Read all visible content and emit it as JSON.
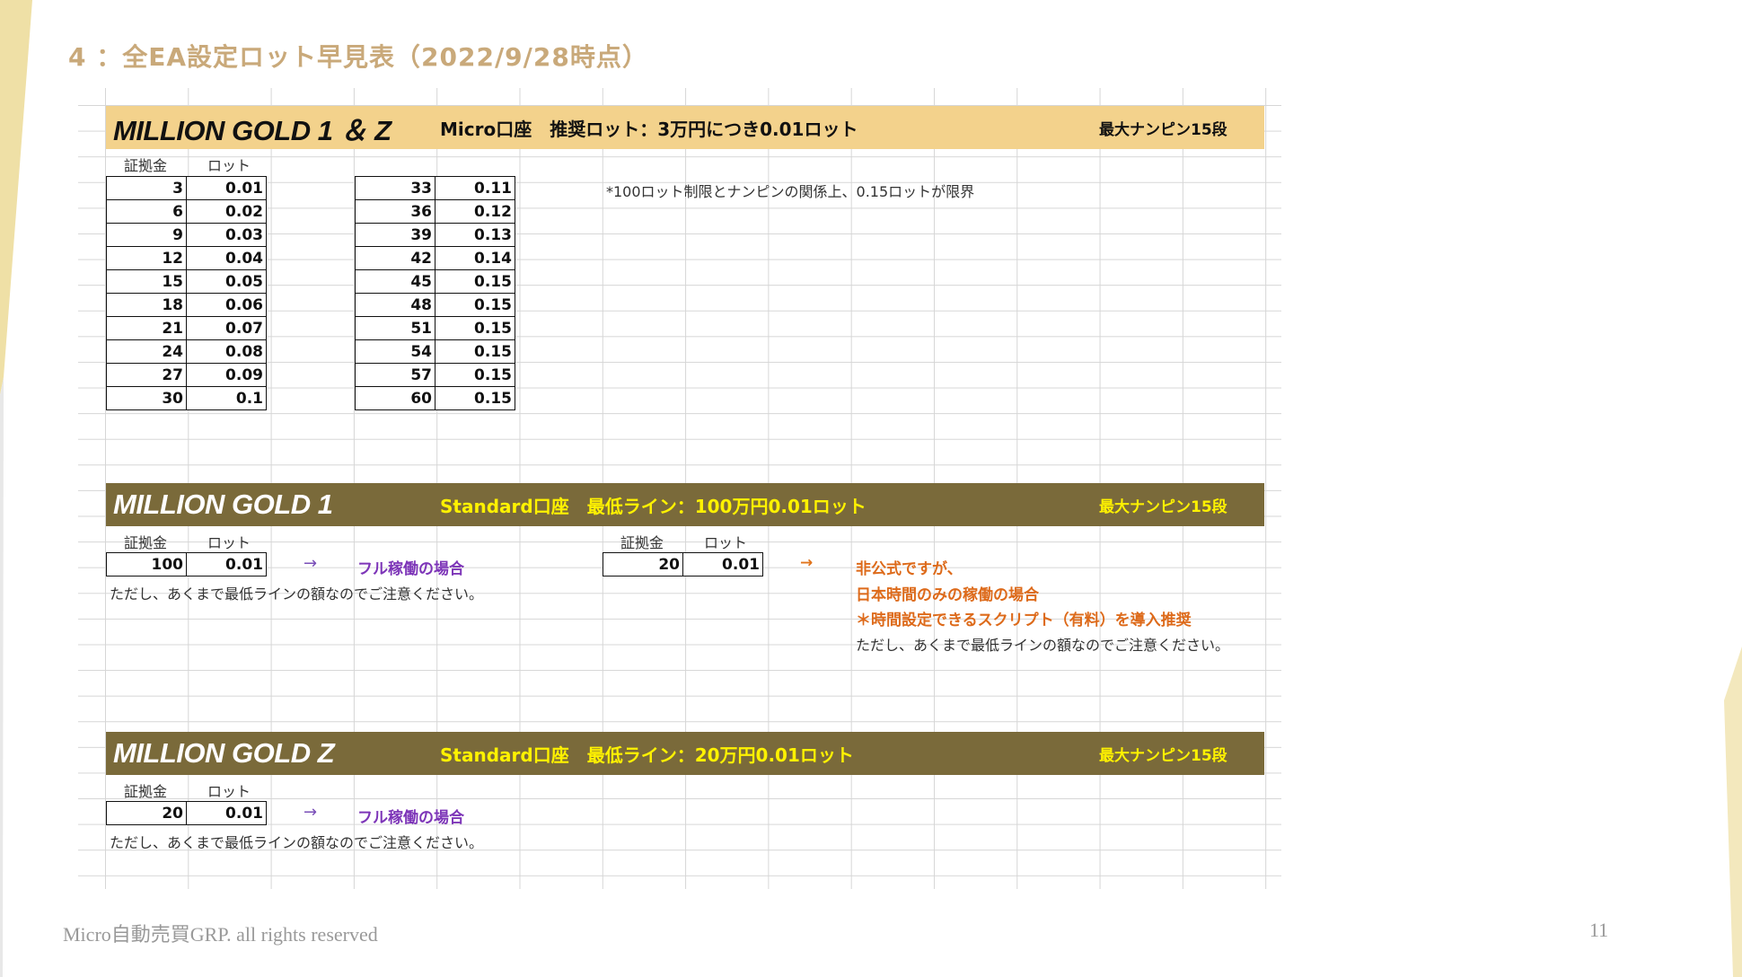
{
  "slide": {
    "title": "4 ：全EA設定ロット早見表（2022/9/28時点）",
    "footer": "Micro自動売買GRP. all rights reserved",
    "page_number": "11",
    "accent_color": "#c9a97a"
  },
  "section1": {
    "name": "MILLION GOLD 1 ＆ Z",
    "subtitle": "Micro口座　推奨ロット：3万円につき0.01ロット",
    "max_nanpin": "最大ナンピン15段",
    "header_margin": "証拠金",
    "header_lot": "ロット",
    "note": "*100ロット制限とナンピンの関係上、0.15ロットが限界",
    "table_left": [
      [
        "3",
        "0.01"
      ],
      [
        "6",
        "0.02"
      ],
      [
        "9",
        "0.03"
      ],
      [
        "12",
        "0.04"
      ],
      [
        "15",
        "0.05"
      ],
      [
        "18",
        "0.06"
      ],
      [
        "21",
        "0.07"
      ],
      [
        "24",
        "0.08"
      ],
      [
        "27",
        "0.09"
      ],
      [
        "30",
        "0.1"
      ]
    ],
    "table_right": [
      [
        "33",
        "0.11"
      ],
      [
        "36",
        "0.12"
      ],
      [
        "39",
        "0.13"
      ],
      [
        "42",
        "0.14"
      ],
      [
        "45",
        "0.15"
      ],
      [
        "48",
        "0.15"
      ],
      [
        "51",
        "0.15"
      ],
      [
        "54",
        "0.15"
      ],
      [
        "57",
        "0.15"
      ],
      [
        "60",
        "0.15"
      ]
    ],
    "band_color": "#f3d28c"
  },
  "section2": {
    "name": "MILLION GOLD 1",
    "subtitle": "Standard口座　最低ライン：100万円0.01ロット",
    "max_nanpin": "最大ナンピン15段",
    "header_margin": "証拠金",
    "header_lot": "ロット",
    "left_margin": "100",
    "left_lot": "0.01",
    "left_arrow": "→",
    "left_label": "フル稼働の場合",
    "left_note": "ただし、あくまで最低ラインの額なのでご注意ください。",
    "right_header_margin": "証拠金",
    "right_header_lot": "ロット",
    "right_margin": "20",
    "right_lot": "0.01",
    "right_arrow": "→",
    "right_line1": "非公式ですが、",
    "right_line2": "日本時間のみの稼働の場合",
    "right_line3": "＊時間設定できるスクリプト（有料）を導入推奨",
    "right_note": "ただし、あくまで最低ラインの額なのでご注意ください。",
    "band_color": "#7a6a3a"
  },
  "section3": {
    "name": "MILLION GOLD Z",
    "subtitle": "Standard口座　最低ライン：20万円0.01ロット",
    "max_nanpin": "最大ナンピン15段",
    "header_margin": "証拠金",
    "header_lot": "ロット",
    "margin": "20",
    "lot": "0.01",
    "arrow": "→",
    "label": "フル稼働の場合",
    "note": "ただし、あくまで最低ラインの額なのでご注意ください。",
    "band_color": "#7a6a3a"
  }
}
